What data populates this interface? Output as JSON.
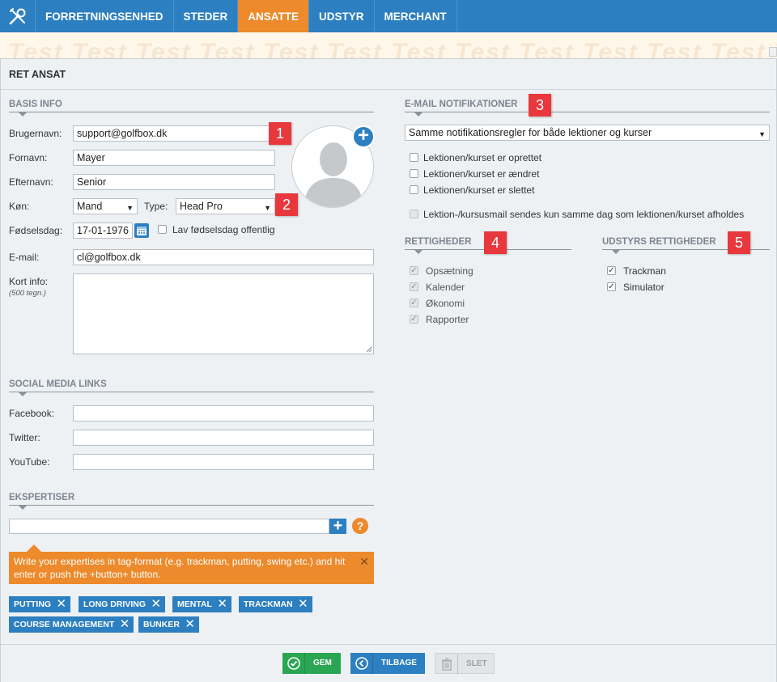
{
  "nav": {
    "tabs": [
      "FORRETNINGSENHED",
      "STEDER",
      "ANSATTE",
      "UDSTYR",
      "MERCHANT"
    ],
    "active": "ANSATTE"
  },
  "banner": {
    "watermark": "Test   Test   Test   Test   Test   Test   Test   Test   Test   Test   Test   Test   Test   Test"
  },
  "form": {
    "title": "RET ANSAT",
    "basis": {
      "heading": "BASIS INFO",
      "username_label": "Brugernavn:",
      "username": "support@golfbox.dk",
      "firstname_label": "Fornavn:",
      "firstname": "Mayer",
      "lastname_label": "Efternavn:",
      "lastname": "Senior",
      "gender_label": "Køn:",
      "gender": "Mand",
      "type_label": "Type:",
      "type": "Head Pro",
      "birthday_label": "Fødselsdag:",
      "birthday": "17-01-1976",
      "public_birthday_label": "Lav fødselsdag offentlig",
      "email_label": "E-mail:",
      "email": "cl@golfbox.dk",
      "shortinfo_label": "Kort info:",
      "shortinfo_sub": "(500 tegn.)"
    },
    "social": {
      "heading": "SOCIAL MEDIA LINKS",
      "facebook_label": "Facebook:",
      "twitter_label": "Twitter:",
      "youtube_label": "YouTube:"
    },
    "expertise": {
      "heading": "EKSPERTISER",
      "help": "?",
      "tip": "Write your expertises in tag-format (e.g. trackman, putting, swing etc.) and hit enter or push the +button+ button.",
      "tags": [
        "PUTTING",
        "LONG DRIVING",
        "MENTAL",
        "TRACKMAN",
        "COURSE MANAGEMENT",
        "BUNKER"
      ]
    },
    "email_notif": {
      "heading": "E-MAIL NOTIFIKATIONER",
      "select": "Samme notifikationsregler for både lektioner og kurser",
      "options": [
        "Lektionen/kurset er oprettet",
        "Lektionen/kurset er ændret",
        "Lektionen/kurset er slettet"
      ],
      "same_day": "Lektion-/kursusmail sendes kun samme dag som lektionen/kurset afholdes"
    },
    "rights": {
      "heading": "RETTIGHEDER",
      "items": [
        "Opsætning",
        "Kalender",
        "Økonomi",
        "Rapporter"
      ]
    },
    "equipment_rights": {
      "heading": "UDSTYRS RETTIGHEDER",
      "items": [
        "Trackman",
        "Simulator"
      ]
    },
    "badges": [
      "1",
      "2",
      "3",
      "4",
      "5"
    ],
    "buttons": {
      "save": "GEM",
      "back": "TILBAGE",
      "delete": "SLET"
    }
  },
  "colors": {
    "nav_blue": "#2c7fc0",
    "nav_active": "#ec8a2c",
    "badge_red": "#e8383d",
    "save_green": "#2aa653"
  }
}
